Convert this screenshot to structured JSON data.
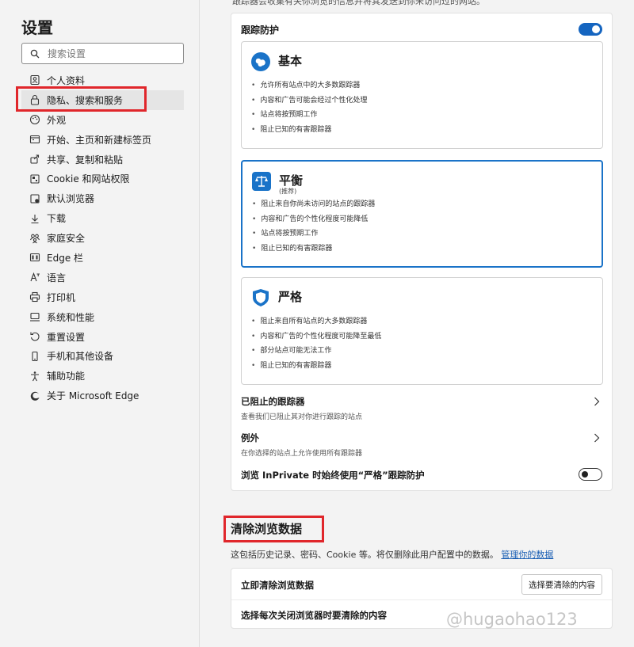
{
  "sidebar": {
    "title": "设置",
    "search_placeholder": "搜索设置",
    "items": [
      {
        "label": "个人资料",
        "icon": "profile-icon"
      },
      {
        "label": "隐私、搜索和服务",
        "icon": "lock-icon"
      },
      {
        "label": "外观",
        "icon": "palette-icon"
      },
      {
        "label": "开始、主页和新建标签页",
        "icon": "home-icon"
      },
      {
        "label": "共享、复制和粘贴",
        "icon": "share-icon"
      },
      {
        "label": "Cookie 和网站权限",
        "icon": "cookie-icon"
      },
      {
        "label": "默认浏览器",
        "icon": "browser-icon"
      },
      {
        "label": "下载",
        "icon": "download-icon"
      },
      {
        "label": "家庭安全",
        "icon": "family-icon"
      },
      {
        "label": "Edge 栏",
        "icon": "edge-bar-icon"
      },
      {
        "label": "语言",
        "icon": "language-icon"
      },
      {
        "label": "打印机",
        "icon": "printer-icon"
      },
      {
        "label": "系统和性能",
        "icon": "system-icon"
      },
      {
        "label": "重置设置",
        "icon": "reset-icon"
      },
      {
        "label": "手机和其他设备",
        "icon": "phone-icon"
      },
      {
        "label": "辅助功能",
        "icon": "accessibility-icon"
      },
      {
        "label": "关于 Microsoft Edge",
        "icon": "edge-logo-icon"
      }
    ],
    "active_index": 1
  },
  "main": {
    "top_cut_text": "跟踪器会收集有关你浏览的信息并将其发送到你未访问过的网站。",
    "tracking": {
      "title": "跟踪防护",
      "enabled": true,
      "levels": [
        {
          "name": "基本",
          "sub": "",
          "selected": false,
          "bullets": [
            "允许所有站点中的大多数跟踪器",
            "内容和广告可能会经过个性化处理",
            "站点将按预期工作",
            "阻止已知的有害跟踪器"
          ]
        },
        {
          "name": "平衡",
          "sub": "(推荐)",
          "selected": true,
          "bullets": [
            "阻止来自你尚未访问的站点的跟踪器",
            "内容和广告的个性化程度可能降低",
            "站点将按预期工作",
            "阻止已知的有害跟踪器"
          ]
        },
        {
          "name": "严格",
          "sub": "",
          "selected": false,
          "bullets": [
            "阻止来自所有站点的大多数跟踪器",
            "内容和广告的个性化程度可能降至最低",
            "部分站点可能无法工作",
            "阻止已知的有害跟踪器"
          ]
        }
      ],
      "blocked": {
        "title": "已阻止的跟踪器",
        "desc": "查看我们已阻止其对你进行跟踪的站点"
      },
      "exceptions": {
        "title": "例外",
        "desc": "在你选择的站点上允许使用所有跟踪器"
      },
      "inprivate": {
        "label": "浏览 InPrivate 时始终使用“严格”跟踪防护",
        "enabled": false
      }
    },
    "clear": {
      "title": "清除浏览数据",
      "desc": "这包括历史记录、密码、Cookie 等。将仅删除此用户配置中的数据。",
      "link": "管理你的数据",
      "row1": "立即清除浏览数据",
      "button": "选择要清除的内容",
      "row2": "选择每次关闭浏览器时要清除的内容"
    }
  },
  "watermark": "@hugaohao123",
  "colors": {
    "accent": "#1565c0",
    "highlight": "#e0262b",
    "selected_border": "#1a73c8"
  }
}
